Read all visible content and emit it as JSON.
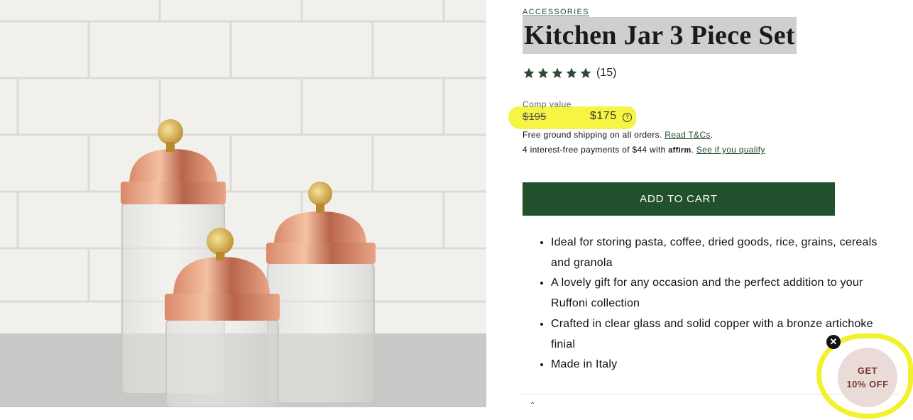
{
  "product": {
    "breadcrumb": "ACCESSORIES",
    "title": "Kitchen Jar 3 Piece Set",
    "rating_stars": 5,
    "rating_count": "(15)",
    "comp_label": "Comp value",
    "old_price": "$195",
    "new_price": "$175",
    "shipping_text": "Free ground shipping on all orders. ",
    "shipping_link": "Read T&Cs",
    "shipping_suffix": ".",
    "affirm_text": "4 interest-free payments of $44 with ",
    "affirm_logo": "affirm",
    "affirm_link": "See if you qualify",
    "add_to_cart": "ADD TO CART",
    "features": [
      "Ideal for storing pasta, coffee, dried goods, rice, grains, cereals and granola",
      "A lovely gift for any occasion and the perfect addition to your Ruffoni collection",
      "Crafted in clear glass and solid copper with a bronze artichoke finial",
      "Made in Italy"
    ],
    "accordion_icon": "chevron-up-icon"
  },
  "promo": {
    "line1": "GET",
    "line2": "10% OFF",
    "close_icon": "close-icon"
  },
  "colors": {
    "brand_green": "#21502d",
    "highlight_yellow": "#f6f43a",
    "promo_bg": "#eadbd8",
    "promo_text": "#7a3a33"
  }
}
